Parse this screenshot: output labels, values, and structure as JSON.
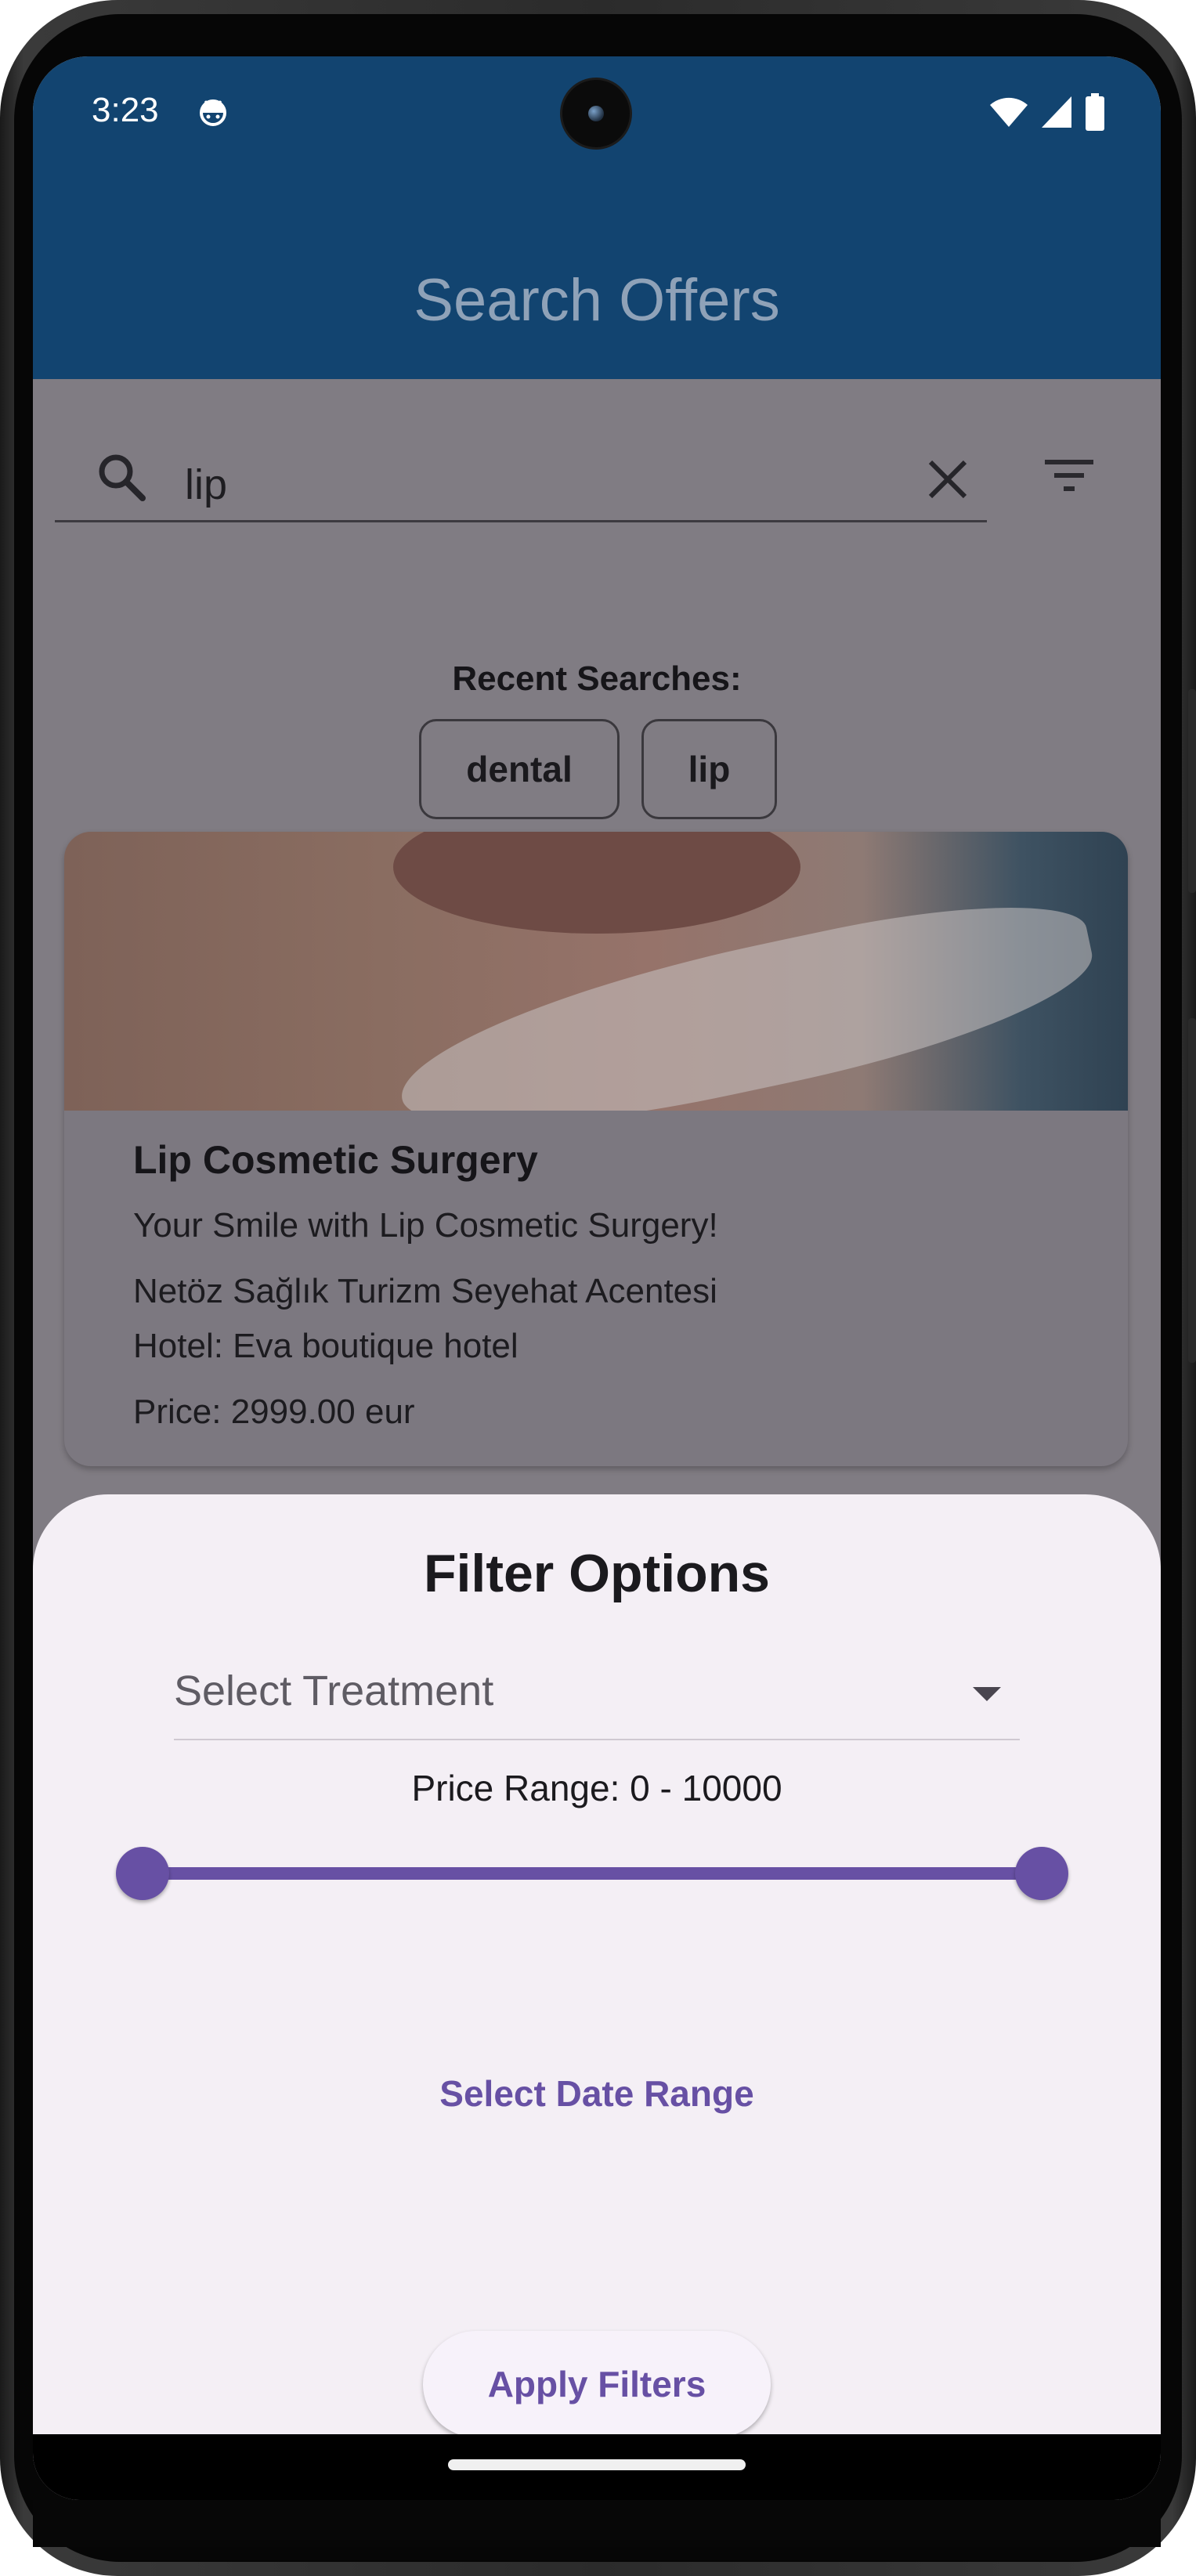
{
  "status_bar": {
    "time": "3:23"
  },
  "app_bar": {
    "title": "Search Offers"
  },
  "search": {
    "value": "lip"
  },
  "recent": {
    "label": "Recent Searches:",
    "chips": [
      "dental",
      "lip"
    ]
  },
  "offers": [
    {
      "title": "Lip Cosmetic Surgery",
      "subtitle": "Your Smile with Lip Cosmetic Surgery!",
      "agency": "Netöz Sağlık Turizm Seyehat Acentesi",
      "hotel": "Hotel: Eva boutique hotel",
      "price": "Price:  2999.00 eur"
    }
  ],
  "filter_sheet": {
    "title": "Filter Options",
    "treatment_placeholder": "Select Treatment",
    "price_range_label": "Price Range: 0 - 10000",
    "price_range": {
      "min": 0,
      "max": 10000,
      "low": 0,
      "high": 10000
    },
    "date_range_button": "Select Date Range",
    "apply_button": "Apply Filters"
  },
  "colors": {
    "app_bar": "#124470",
    "accent": "#6750a4",
    "sheet_bg": "#f4eff5",
    "scrim_content": "#807c83"
  },
  "icons": [
    "android-status-icon",
    "wifi-icon",
    "signal-icon",
    "battery-icon",
    "search-icon",
    "close-icon",
    "filter-icon",
    "dropdown-arrow-icon"
  ]
}
